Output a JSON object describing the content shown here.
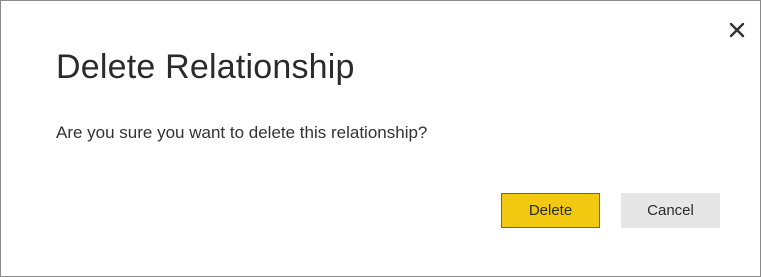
{
  "dialog": {
    "title": "Delete Relationship",
    "message": "Are you sure you want to delete this relationship?",
    "buttons": {
      "delete_label": "Delete",
      "cancel_label": "Cancel"
    },
    "close_icon": "close-icon",
    "colors": {
      "primary_button": "#f2c811",
      "secondary_button": "#e6e6e6",
      "border": "#8a8a8a",
      "text": "#2b2b2b"
    }
  }
}
